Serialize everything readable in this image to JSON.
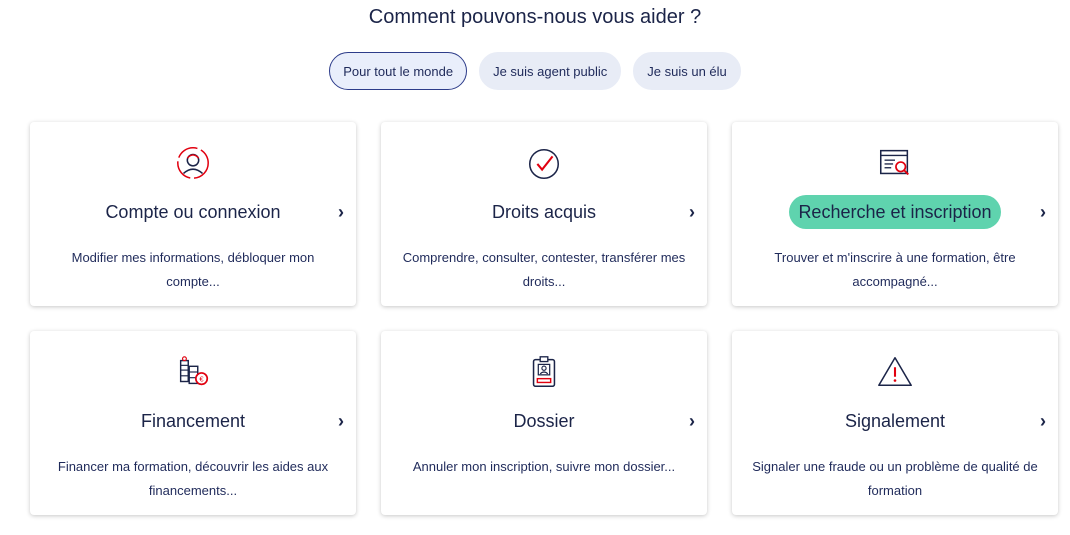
{
  "heading": "Comment pouvons-nous vous aider ?",
  "audience": [
    {
      "label": "Pour tout le monde",
      "active": true
    },
    {
      "label": "Je suis agent public",
      "active": false
    },
    {
      "label": "Je suis un élu",
      "active": false
    }
  ],
  "cards": [
    {
      "title": "Compte ou connexion",
      "desc": "Modifier mes informations, débloquer mon compte...",
      "icon": "user-account-icon",
      "chevron": "›"
    },
    {
      "title": "Droits acquis",
      "desc": "Comprendre, consulter, contester, transférer mes droits...",
      "icon": "check-circle-icon",
      "chevron": "›"
    },
    {
      "title": "Recherche et inscription",
      "desc": "Trouver et m'inscrire à une formation, être accompagné...",
      "icon": "search-document-icon",
      "chevron": "›"
    },
    {
      "title": "Financement",
      "desc": "Financer ma formation, découvrir les aides aux financements...",
      "icon": "coins-icon",
      "chevron": "›"
    },
    {
      "title": "Dossier",
      "desc": "Annuler mon inscription, suivre mon dossier...",
      "icon": "badge-clipboard-icon",
      "chevron": "›"
    },
    {
      "title": "Signalement",
      "desc": "Signaler une fraude ou un problème de qualité de formation",
      "icon": "warning-triangle-icon",
      "chevron": "›"
    }
  ],
  "colors": {
    "primary": "#1b2448",
    "accent": "#e1000f",
    "highlight": "#5fd3ae"
  }
}
